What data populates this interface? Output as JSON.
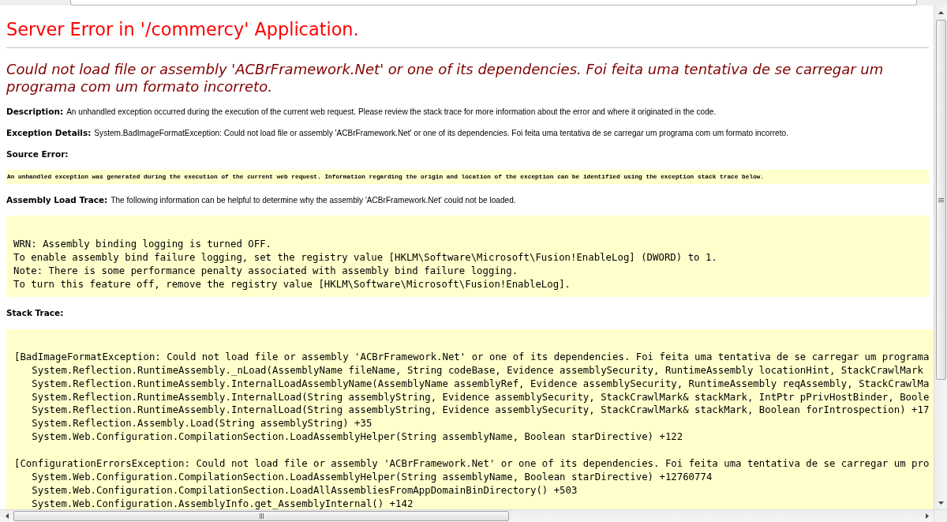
{
  "page": {
    "title": "Server Error in '/commercy' Application.",
    "error_message": "Could not load file or assembly 'ACBrFramework.Net' or one of its dependencies. Foi feita uma tentativa de se carregar um programa com um formato incorreto.",
    "sections": [
      {
        "label": "Description:",
        "text": "An unhandled exception occurred during the execution of the current web request. Please review the stack trace for more information about the error and where it originated in the code."
      },
      {
        "label": "Exception Details:",
        "text": "System.BadImageFormatException: Could not load file or assembly 'ACBrFramework.Net' or one of its dependencies. Foi feita uma tentativa de se carregar um programa com um formato incorreto."
      },
      {
        "label": "Source Error:",
        "box": {
          "kind": "note",
          "lines": [
            "An unhandled exception was generated during the execution of the current web request. Information regarding the origin and location of the exception can be identified using the exception stack trace below."
          ]
        }
      },
      {
        "label": "Assembly Load Trace:",
        "text": "The following information can be helpful to determine why the assembly 'ACBrFramework.Net' could not be loaded.",
        "box": {
          "kind": "listing",
          "lines": [
            "WRN: Assembly binding logging is turned OFF.",
            "To enable assembly bind failure logging, set the registry value [HKLM\\Software\\Microsoft\\Fusion!EnableLog] (DWORD) to 1.",
            "Note: There is some performance penalty associated with assembly bind failure logging.",
            "To turn this feature off, remove the registry value [HKLM\\Software\\Microsoft\\Fusion!EnableLog]."
          ]
        }
      },
      {
        "label": "Stack Trace:",
        "box": {
          "kind": "trace",
          "exceptions": [
            {
              "text": "[BadImageFormatException: Could not load file or assembly 'ACBrFramework.Net' or one of its dependencies. Foi feita uma tentativa de se carregar um programa",
              "children": [
                "System.Reflection.RuntimeAssembly._nLoad(AssemblyName fileName, String codeBase, Evidence assemblySecurity, RuntimeAssembly locationHint, StackCrawlMark",
                "System.Reflection.RuntimeAssembly.InternalLoadAssemblyName(AssemblyName assemblyRef, Evidence assemblySecurity, RuntimeAssembly reqAssembly, StackCrawlMa",
                "System.Reflection.RuntimeAssembly.InternalLoad(String assemblyString, Evidence assemblySecurity, StackCrawlMark& stackMark, IntPtr pPrivHostBinder, Boole",
                "System.Reflection.RuntimeAssembly.InternalLoad(String assemblyString, Evidence assemblySecurity, StackCrawlMark& stackMark, Boolean forIntrospection) +17",
                "System.Reflection.Assembly.Load(String assemblyString) +35",
                "System.Web.Configuration.CompilationSection.LoadAssemblyHelper(String assemblyName, Boolean starDirective) +122"
              ]
            },
            {
              "text": "[ConfigurationErrorsException: Could not load file or assembly 'ACBrFramework.Net' or one of its dependencies. Foi feita uma tentativa de se carregar um pro",
              "children": [
                "System.Web.Configuration.CompilationSection.LoadAssemblyHelper(String assemblyName, Boolean starDirective) +12760774",
                "System.Web.Configuration.CompilationSection.LoadAllAssembliesFromAppDomainBinDirectory() +503",
                "System.Web.Configuration.AssemblyInfo.get_AssemblyInternal() +142"
              ]
            }
          ]
        }
      }
    ]
  }
}
